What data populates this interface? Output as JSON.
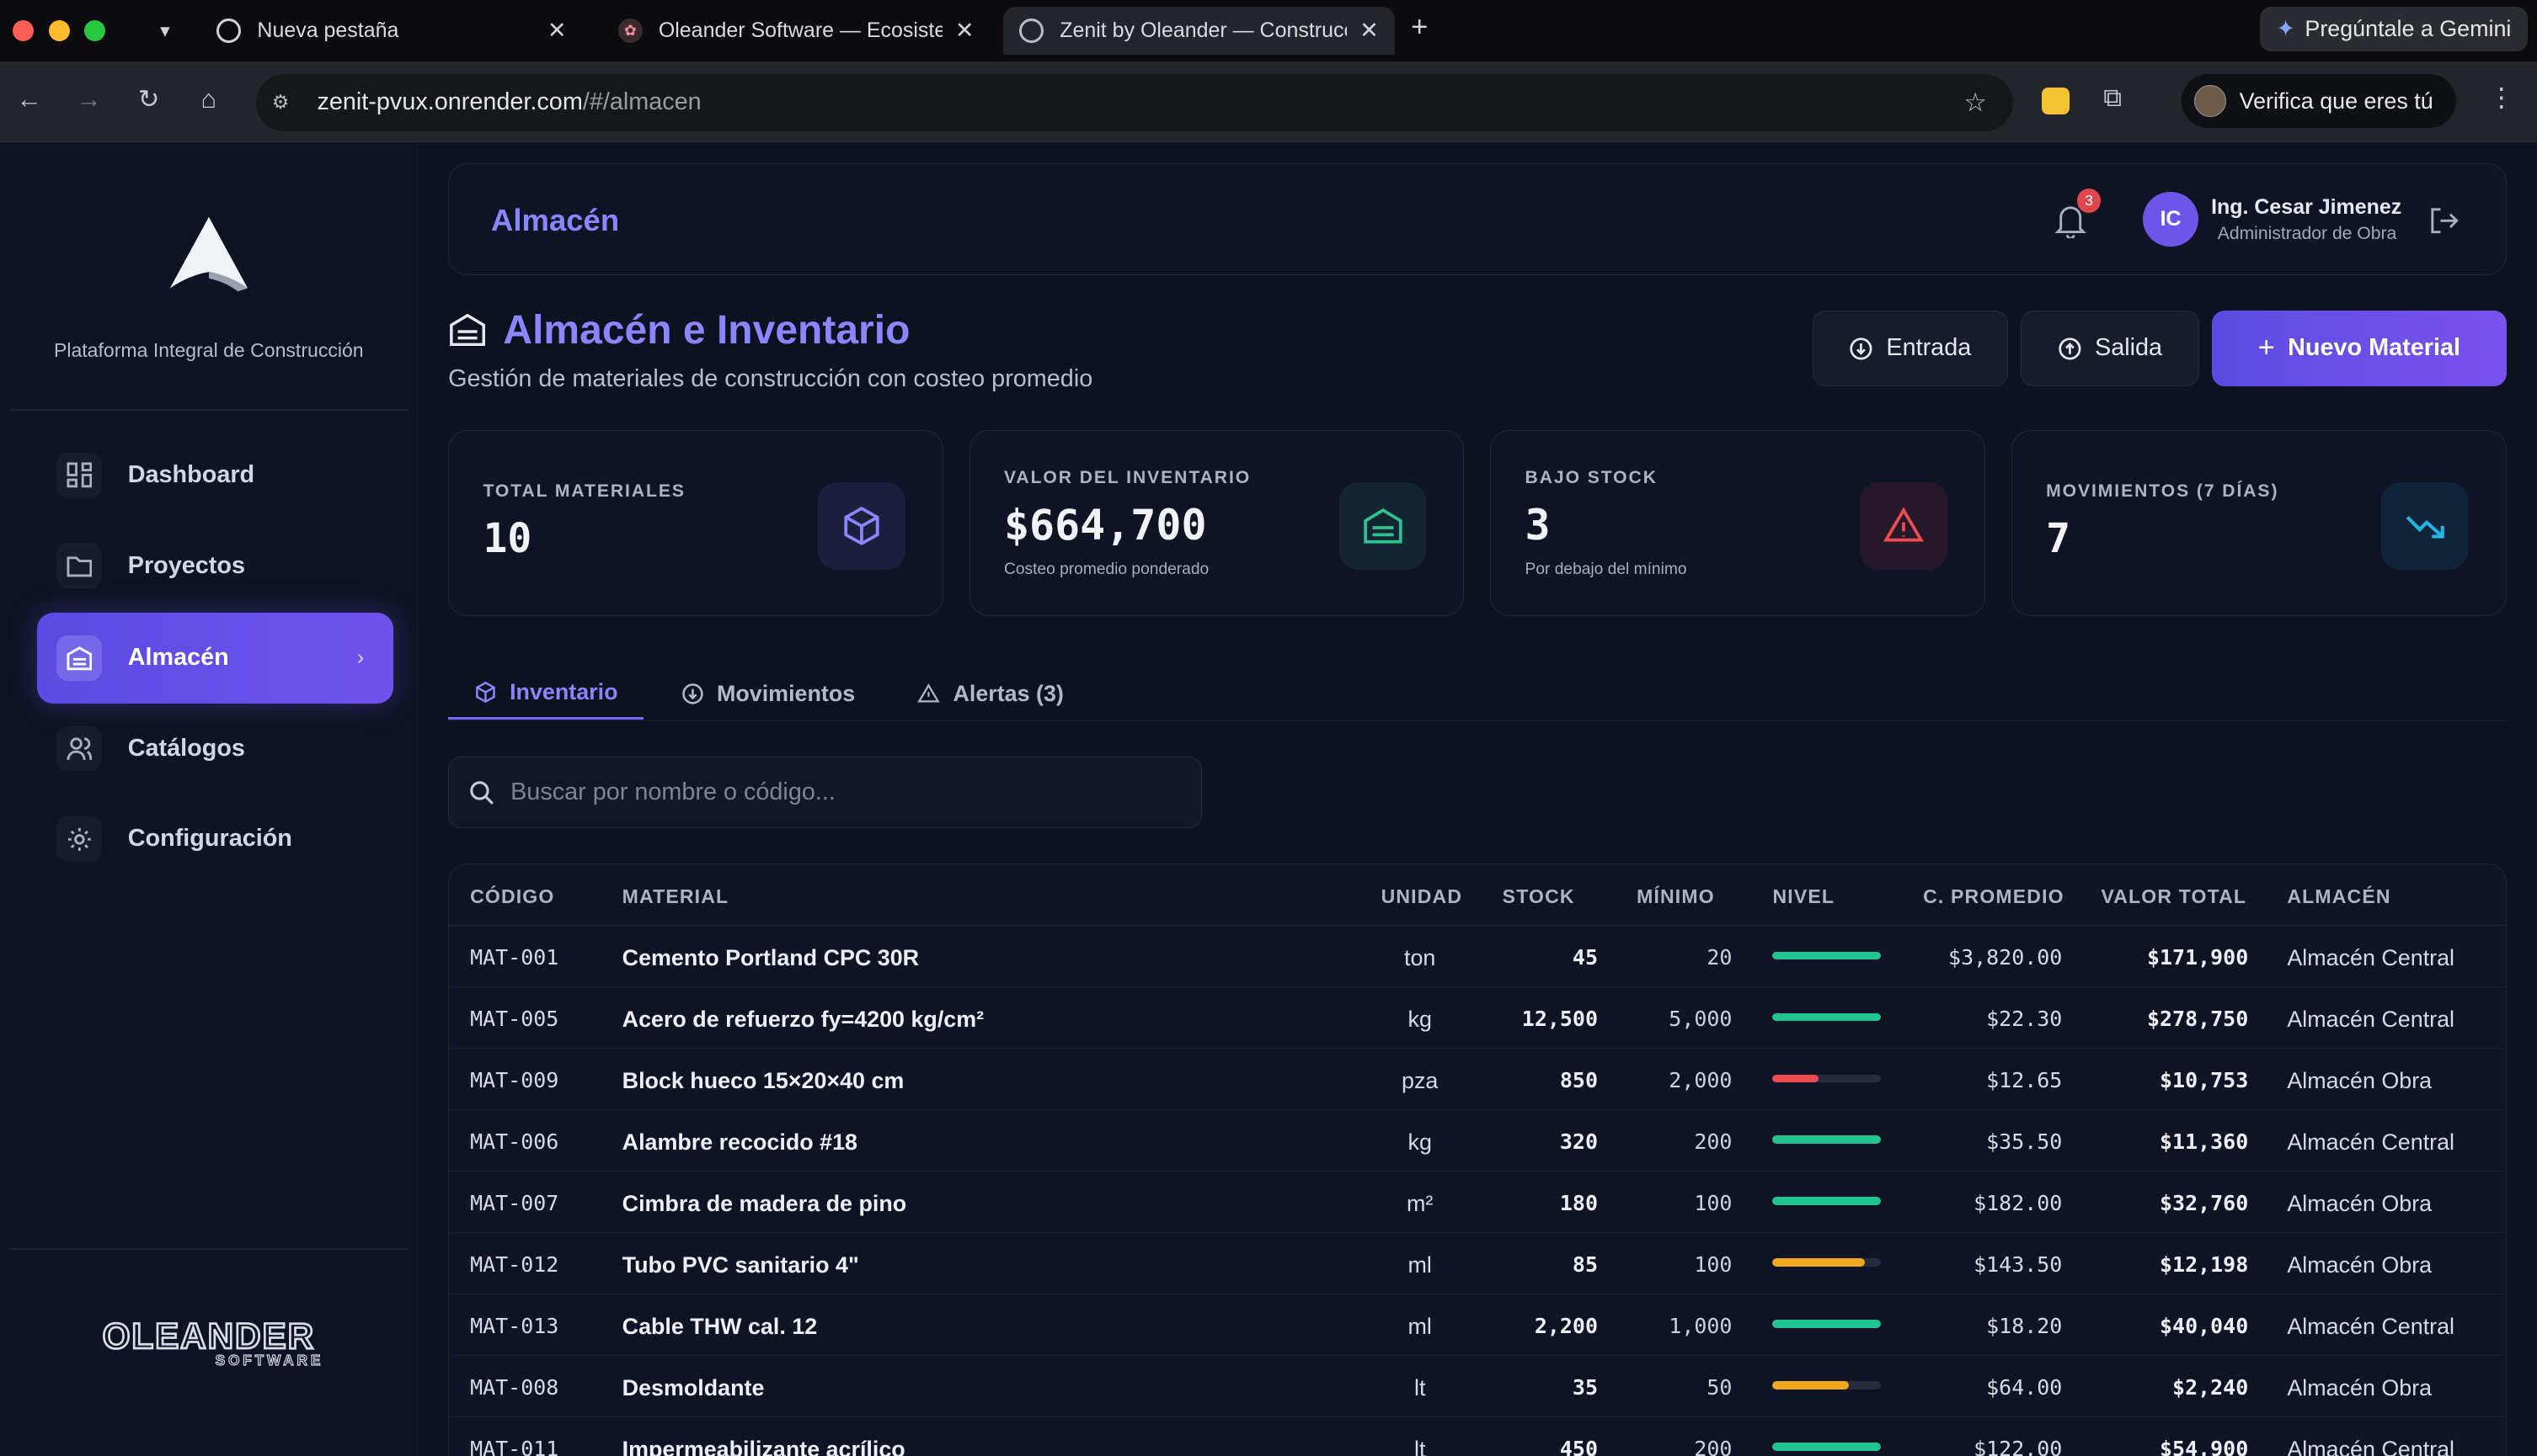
{
  "browser": {
    "tabs": [
      {
        "title": "Nueva pestaña"
      },
      {
        "title": "Oleander Software — Ecosistema"
      },
      {
        "title": "Zenit by Oleander — Construcción"
      }
    ],
    "url_host": "zenit-pvux.onrender.com",
    "url_path": "/#/almacen",
    "gemini_label": "Pregúntale a Gemini",
    "verify_label": "Verifica que eres tú"
  },
  "sidebar": {
    "tagline": "Plataforma Integral de Construcción",
    "items": [
      {
        "label": "Dashboard",
        "icon": "dashboard-icon"
      },
      {
        "label": "Proyectos",
        "icon": "folder-icon"
      },
      {
        "label": "Almacén",
        "icon": "warehouse-icon",
        "active": true
      },
      {
        "label": "Catálogos",
        "icon": "users-icon"
      },
      {
        "label": "Configuración",
        "icon": "gear-icon"
      }
    ],
    "brand": "OLEANDER",
    "brand_sub": "SOFTWARE"
  },
  "header": {
    "page_title": "Almacén",
    "notifications": "3",
    "user_initials": "IC",
    "user_name": "Ing. Cesar Jimenez",
    "user_role": "Administrador de Obra"
  },
  "page": {
    "title": "Almacén e Inventario",
    "subtitle": "Gestión de materiales de construcción con costeo promedio",
    "btn_entrada": "Entrada",
    "btn_salida": "Salida",
    "btn_nuevo": "Nuevo Material"
  },
  "stats": [
    {
      "label": "TOTAL MATERIALES",
      "value": "10",
      "sub": "",
      "icon": "box-icon",
      "color": "#8b86ff"
    },
    {
      "label": "VALOR DEL INVENTARIO",
      "value": "$664,700",
      "sub": "Costeo promedio ponderado",
      "icon": "warehouse-icon",
      "color": "#2fc28f"
    },
    {
      "label": "BAJO STOCK",
      "value": "3",
      "sub": "Por debajo del mínimo",
      "icon": "alert-icon",
      "color": "#ef4b51"
    },
    {
      "label": "MOVIMIENTOS (7 DÍAS)",
      "value": "7",
      "sub": "",
      "icon": "trend-down-icon",
      "color": "#20b7e8"
    }
  ],
  "tabs": [
    {
      "label": "Inventario",
      "active": true
    },
    {
      "label": "Movimientos"
    },
    {
      "label": "Alertas (3)"
    }
  ],
  "search": {
    "placeholder": "Buscar por nombre o código..."
  },
  "table": {
    "headers": [
      "CÓDIGO",
      "MATERIAL",
      "UNIDAD",
      "STOCK",
      "MÍNIMO",
      "NIVEL",
      "C. PROMEDIO",
      "VALOR TOTAL",
      "ALMACÉN"
    ],
    "rows": [
      {
        "code": "MAT-001",
        "material": "Cemento Portland CPC 30R",
        "unit": "ton",
        "stock": "45",
        "min": "20",
        "level": 1.0,
        "level_color": "#22c58f",
        "avg": "$3,820.00",
        "total": "$171,900",
        "warehouse": "Almacén Central"
      },
      {
        "code": "MAT-005",
        "material": "Acero de refuerzo fy=4200 kg/cm²",
        "unit": "kg",
        "stock": "12,500",
        "min": "5,000",
        "level": 1.0,
        "level_color": "#22c58f",
        "avg": "$22.30",
        "total": "$278,750",
        "warehouse": "Almacén Central"
      },
      {
        "code": "MAT-009",
        "material": "Block hueco 15×20×40 cm",
        "unit": "pza",
        "stock": "850",
        "min": "2,000",
        "level": 0.42,
        "level_color": "#ef4b51",
        "avg": "$12.65",
        "total": "$10,753",
        "warehouse": "Almacén Obra"
      },
      {
        "code": "MAT-006",
        "material": "Alambre recocido #18",
        "unit": "kg",
        "stock": "320",
        "min": "200",
        "level": 1.0,
        "level_color": "#22c58f",
        "avg": "$35.50",
        "total": "$11,360",
        "warehouse": "Almacén Central"
      },
      {
        "code": "MAT-007",
        "material": "Cimbra de madera de pino",
        "unit": "m²",
        "stock": "180",
        "min": "100",
        "level": 1.0,
        "level_color": "#22c58f",
        "avg": "$182.00",
        "total": "$32,760",
        "warehouse": "Almacén Obra"
      },
      {
        "code": "MAT-012",
        "material": "Tubo PVC sanitario 4\"",
        "unit": "ml",
        "stock": "85",
        "min": "100",
        "level": 0.85,
        "level_color": "#f2a81d",
        "avg": "$143.50",
        "total": "$12,198",
        "warehouse": "Almacén Obra"
      },
      {
        "code": "MAT-013",
        "material": "Cable THW cal. 12",
        "unit": "ml",
        "stock": "2,200",
        "min": "1,000",
        "level": 1.0,
        "level_color": "#22c58f",
        "avg": "$18.20",
        "total": "$40,040",
        "warehouse": "Almacén Central"
      },
      {
        "code": "MAT-008",
        "material": "Desmoldante",
        "unit": "lt",
        "stock": "35",
        "min": "50",
        "level": 0.7,
        "level_color": "#f2a81d",
        "avg": "$64.00",
        "total": "$2,240",
        "warehouse": "Almacén Obra"
      },
      {
        "code": "MAT-011",
        "material": "Impermeabilizante acrílico",
        "unit": "lt",
        "stock": "450",
        "min": "200",
        "level": 1.0,
        "level_color": "#22c58f",
        "avg": "$122.00",
        "total": "$54,900",
        "warehouse": "Almacén Central"
      }
    ]
  }
}
